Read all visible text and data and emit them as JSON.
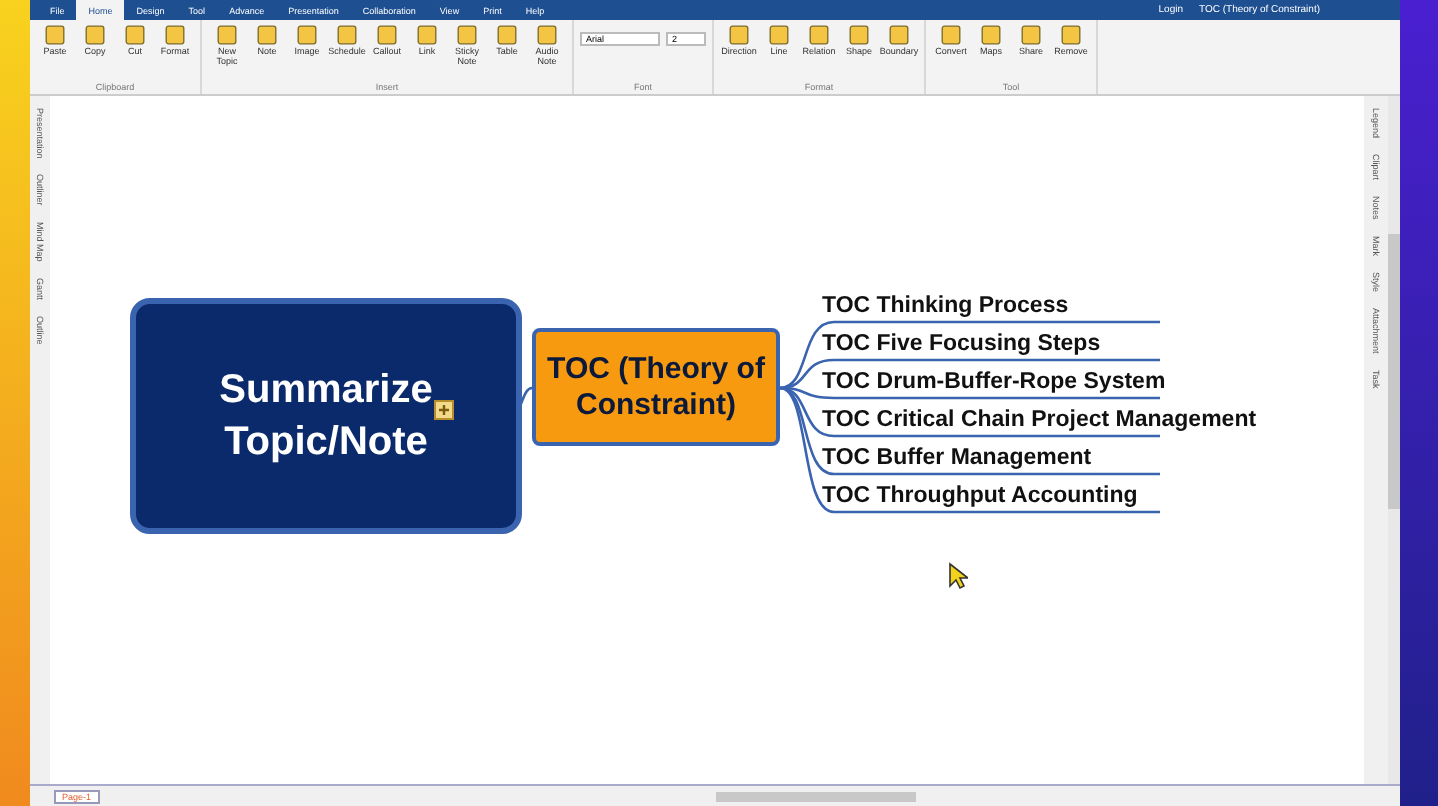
{
  "window": {
    "login": "Login",
    "title": "TOC (Theory of Constraint)"
  },
  "tabs": [
    {
      "label": "File",
      "selected": false
    },
    {
      "label": "Home",
      "selected": true
    },
    {
      "label": "Design",
      "selected": false
    },
    {
      "label": "Tool",
      "selected": false
    },
    {
      "label": "Advance",
      "selected": false
    },
    {
      "label": "Presentation",
      "selected": false
    },
    {
      "label": "Collaboration",
      "selected": false
    },
    {
      "label": "View",
      "selected": false
    },
    {
      "label": "Print",
      "selected": false
    },
    {
      "label": "Help",
      "selected": false
    }
  ],
  "ribbon_groups": [
    {
      "label": "Clipboard",
      "items": [
        {
          "label": "Paste"
        },
        {
          "label": "Copy"
        },
        {
          "label": "Cut"
        },
        {
          "label": "Format"
        }
      ]
    },
    {
      "label": "Insert",
      "items": [
        {
          "label": "New Topic"
        },
        {
          "label": "Note"
        },
        {
          "label": "Image"
        },
        {
          "label": "Schedule"
        },
        {
          "label": "Callout"
        },
        {
          "label": "Link"
        },
        {
          "label": "Sticky Note"
        },
        {
          "label": "Table"
        },
        {
          "label": "Audio Note"
        }
      ]
    },
    {
      "label": "Font",
      "font": "Arial",
      "size": "2"
    },
    {
      "label": "Format",
      "items": [
        {
          "label": "Direction"
        },
        {
          "label": "Line"
        },
        {
          "label": "Relation"
        },
        {
          "label": "Shape"
        },
        {
          "label": "Boundary"
        }
      ]
    },
    {
      "label": "Tool",
      "items": [
        {
          "label": "Convert"
        },
        {
          "label": "Maps"
        },
        {
          "label": "Share"
        },
        {
          "label": "Remove"
        }
      ]
    }
  ],
  "left_sidebar": [
    "Presentation",
    "Outliner",
    "Mind Map",
    "Gantt",
    "Outline"
  ],
  "right_sidebar": [
    "Legend",
    "Clipart",
    "Notes",
    "Mark",
    "Style",
    "Attachment",
    "Task"
  ],
  "mind_map": {
    "central": "Summarize Topic/Note",
    "main": "TOC (Theory of Constraint)",
    "branches": [
      "TOC  Thinking  Process",
      "TOC  Five  Focusing  Steps",
      "TOC  Drum-Buffer-Rope  System",
      "TOC  Critical  Chain  Project  Management",
      "TOC  Buffer  Management",
      "TOC  Throughput  Accounting"
    ]
  },
  "page_tabs": [
    {
      "label": "Page-1",
      "selected": true
    }
  ]
}
